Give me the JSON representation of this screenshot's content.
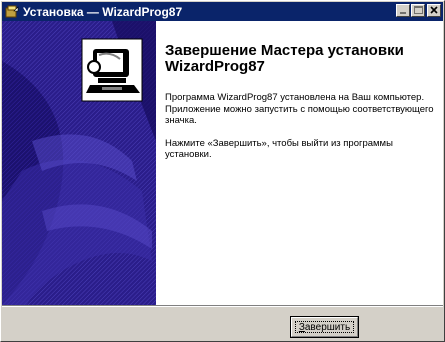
{
  "window": {
    "title": "Установка — WizardProg87",
    "title_icon": "setup-icon",
    "buttons": [
      "minimize-icon",
      "maximize-icon",
      "close-icon"
    ]
  },
  "wizard": {
    "heading_line1": "Завершение Мастера установки",
    "heading_line2": "WizardProg87",
    "paragraph1": "Программа WizardProg87 установлена на Ваш компьютер. Приложение можно запустить с помощью соответствующего значка.",
    "paragraph2": "Нажмите «Завершить», чтобы выйти из программы установки.",
    "sidebar_image": "wizard-sidebar-image",
    "sidebar_icon": "installer-computer-icon"
  },
  "footer": {
    "finish_button_first": "З",
    "finish_button_rest": "авершить"
  },
  "colors": {
    "titlebar": "#0a246a",
    "sidebar_dark": "#1a0f6b",
    "sidebar_mid": "#3c2fa5",
    "face": "#d4d0c8"
  }
}
